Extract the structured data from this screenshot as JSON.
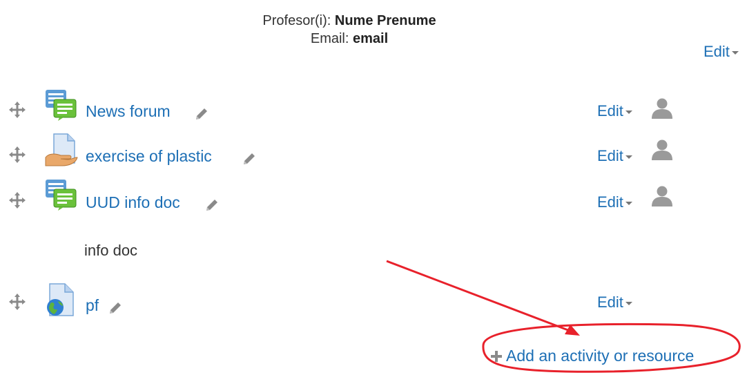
{
  "header": {
    "teacher_label": "Profesor(i): ",
    "teacher_name": "Nume Prenume",
    "email_label": "Email: ",
    "email_value": "email",
    "edit_label": "Edit"
  },
  "activities": [
    {
      "name": "News forum",
      "icon": "forum-icon",
      "edit_label": "Edit"
    },
    {
      "name": "exercise of plastic",
      "icon": "assignment-icon",
      "edit_label": "Edit"
    },
    {
      "name": "UUD info doc",
      "icon": "forum-icon",
      "edit_label": "Edit",
      "description": "info doc"
    },
    {
      "name": "pf",
      "icon": "url-icon",
      "edit_label": "Edit"
    }
  ],
  "add_activity": {
    "label": "Add an activity or resource",
    "icon": "plus-icon"
  },
  "annotation_color": "#e8212b",
  "link_color": "#1d6fb5"
}
